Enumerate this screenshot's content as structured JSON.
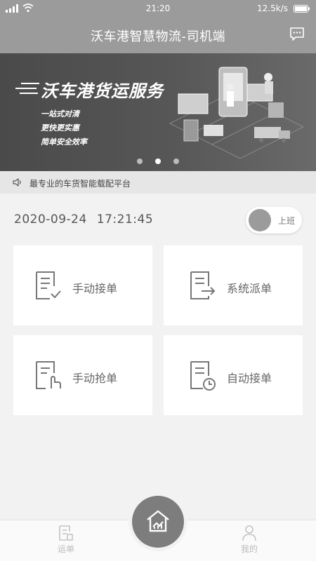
{
  "status_bar": {
    "time": "21:20",
    "speed": "12.5k/s"
  },
  "header": {
    "title": "沃车港智慧物流-司机端",
    "message_icon": "message-icon"
  },
  "banner": {
    "title": "沃车港货运服务",
    "lines": [
      "一站式对清",
      "更快更实惠",
      "简单安全效率"
    ],
    "active_dot": 1,
    "dot_count": 3
  },
  "notice": {
    "text": "最专业的车货智能载配平台"
  },
  "datetime": {
    "date": "2020-09-24",
    "time": "17:21:45"
  },
  "toggle": {
    "label": "上班",
    "on": false
  },
  "cards": [
    {
      "label": "手动接单",
      "icon": "document-check-icon"
    },
    {
      "label": "系统派单",
      "icon": "document-arrow-icon"
    },
    {
      "label": "手动抢单",
      "icon": "document-tap-icon"
    },
    {
      "label": "自动接单",
      "icon": "document-clock-icon"
    }
  ],
  "bottom_nav": {
    "left_label": "运单",
    "right_label": "我的",
    "center_icon": "home-chart-icon"
  },
  "colors": {
    "header_bg": "#9b9b9b",
    "accent": "#7d7d7d",
    "page_bg": "#f2f2f2"
  }
}
